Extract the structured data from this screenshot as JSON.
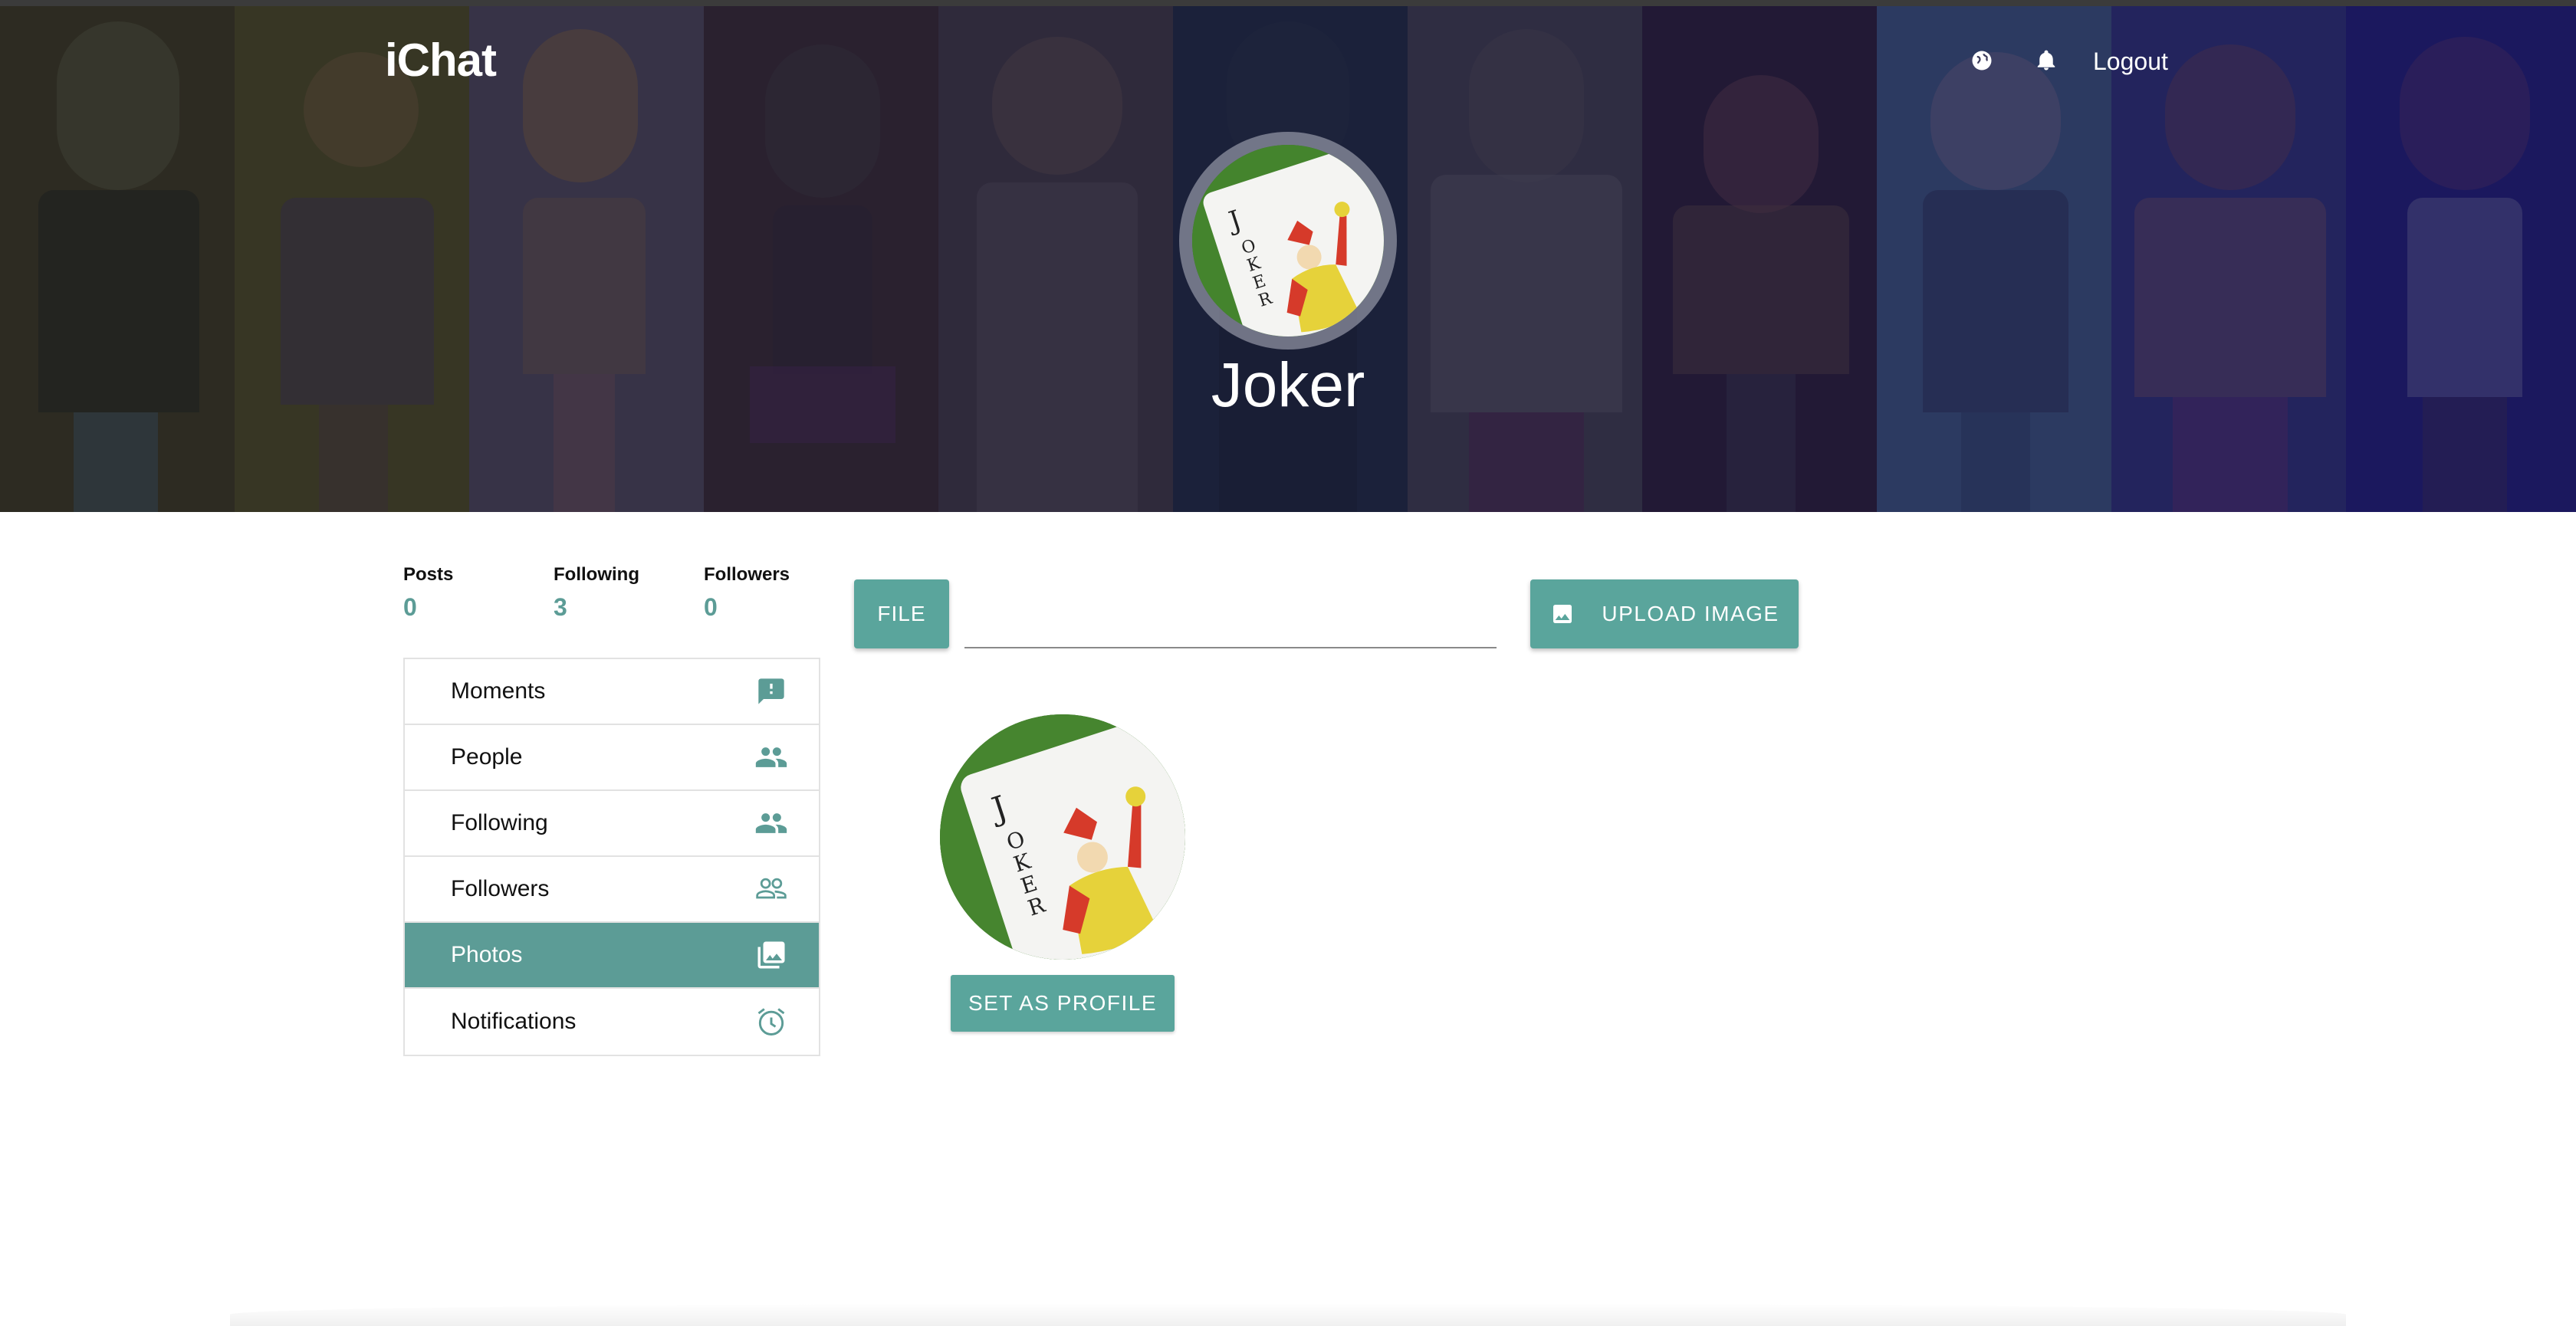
{
  "app": {
    "brand": "iChat",
    "logout_label": "Logout"
  },
  "header_icons": [
    "globe-icon",
    "bell-icon"
  ],
  "profile": {
    "name": "Joker"
  },
  "stats": [
    {
      "label": "Posts",
      "value": "0"
    },
    {
      "label": "Following",
      "value": "3"
    },
    {
      "label": "Followers",
      "value": "0"
    }
  ],
  "menu": {
    "items": [
      {
        "label": "Moments",
        "icon": "feedback-icon",
        "active": false
      },
      {
        "label": "People",
        "icon": "people-icon",
        "active": false
      },
      {
        "label": "Following",
        "icon": "people-icon",
        "active": false
      },
      {
        "label": "Followers",
        "icon": "people-outline-icon",
        "active": false
      },
      {
        "label": "Photos",
        "icon": "photo-library-icon",
        "active": true
      },
      {
        "label": "Notifications",
        "icon": "alarm-icon",
        "active": false
      }
    ]
  },
  "upload": {
    "file_label": "FILE",
    "file_value": "",
    "upload_label": "UPLOAD IMAGE"
  },
  "photos": {
    "set_profile_label": "SET AS PROFILE"
  },
  "colors": {
    "accent": "#5aa59c",
    "stat_value": "#5c9c96"
  }
}
